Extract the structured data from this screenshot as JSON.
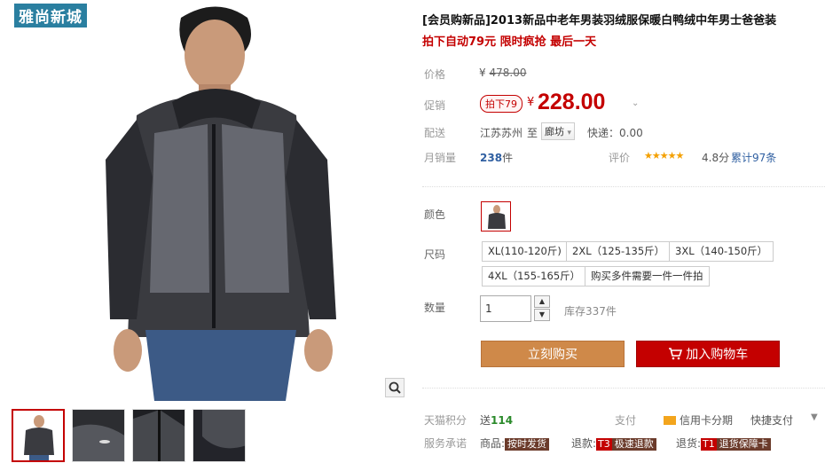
{
  "gallery": {
    "brand_tag": "雅尚新城",
    "zoom_icon": "magnifier-icon",
    "thumbnail_count": 4
  },
  "product": {
    "title": "[会员购新品]2013新品中老年男装羽绒服保暖白鸭绒中年男士爸爸装",
    "subtitle": "拍下自动79元 限时疯抢 最后一天"
  },
  "price": {
    "label": "价格",
    "currency": "¥",
    "original": "478.00"
  },
  "promo": {
    "label": "促销",
    "tag": "拍下79",
    "currency": "¥",
    "value": "228.00"
  },
  "shipping": {
    "label": "配送",
    "from": "江苏苏州",
    "to_word": "至",
    "dest": "廊坊",
    "fee": "快递：0.00"
  },
  "sales": {
    "label": "月销量",
    "count": "238",
    "unit": "件",
    "rating_label": "评价",
    "stars": "★★★★★",
    "score": "4.8分",
    "reviews": "累计97条"
  },
  "sku": {
    "color_label": "颜色",
    "size_label": "尺码",
    "sizes": [
      "XL(110-120斤)",
      "2XL（125-135斤）",
      "3XL（140-150斤）",
      "4XL（155-165斤）",
      "购买多件需要一件一件拍"
    ]
  },
  "quantity": {
    "label": "数量",
    "value": "1",
    "stock": "库存337件"
  },
  "actions": {
    "buy_now": "立刻购买",
    "add_to_cart": "加入购物车"
  },
  "footer": {
    "points_label": "天猫积分",
    "points_prefix": "送",
    "points_value": "114",
    "pay_label": "支付",
    "credit": "信用卡分期",
    "quick_pay": "快捷支付",
    "service_label": "服务承诺",
    "goods_label": "商品:",
    "goods_badge": "按时发货",
    "refund_label": "退款:",
    "refund_code": "T3",
    "refund_badge": "极速退款",
    "return_label": "退货:",
    "return_code": "T1",
    "return_badge": "退货保障卡"
  },
  "colors": {
    "accent": "#c40000",
    "buy_button": "#cf8949",
    "brand_tag": "#2a7fa0",
    "link": "#2f5fa1"
  }
}
